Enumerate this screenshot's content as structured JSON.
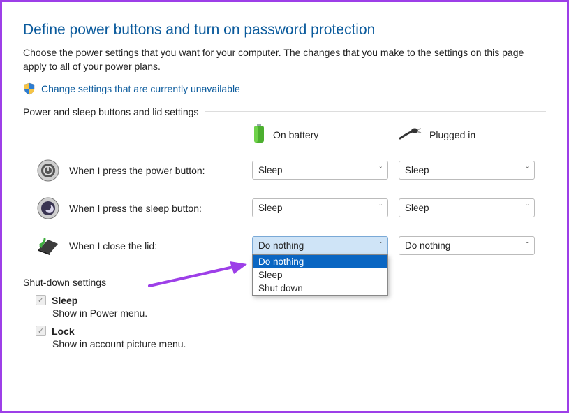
{
  "title": "Define power buttons and turn on password protection",
  "description": "Choose the power settings that you want for your computer. The changes that you make to the settings on this page apply to all of your power plans.",
  "change_link": "Change settings that are currently unavailable",
  "section1_header": "Power and sleep buttons and lid settings",
  "columns": {
    "battery": "On battery",
    "plugged": "Plugged in"
  },
  "rows": {
    "power_button": "When I press the power button:",
    "sleep_button": "When I press the sleep button:",
    "lid": "When I close the lid:"
  },
  "values": {
    "power_battery": "Sleep",
    "power_plugged": "Sleep",
    "sleep_battery": "Sleep",
    "sleep_plugged": "Sleep",
    "lid_battery": "Do nothing",
    "lid_plugged": "Do nothing"
  },
  "lid_dropdown_options": {
    "o0": "Do nothing",
    "o1": "Sleep",
    "o2": "Shut down"
  },
  "section2_header": "Shut-down settings",
  "shutdown": {
    "sleep_label": "Sleep",
    "sleep_desc": "Show in Power menu.",
    "lock_label": "Lock",
    "lock_desc": "Show in account picture menu."
  }
}
